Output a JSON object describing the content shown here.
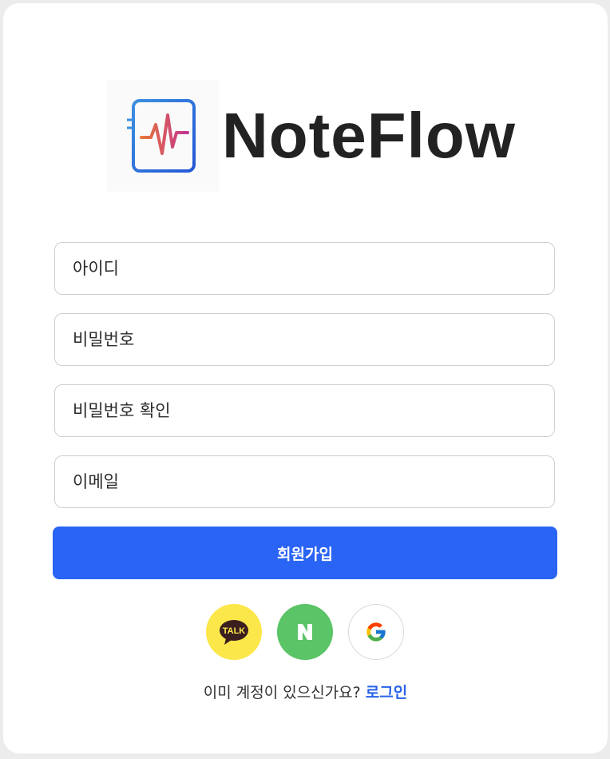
{
  "brand": {
    "name": "NoteFlow",
    "logo_icon": "notebook-waveform-icon"
  },
  "form": {
    "id_placeholder": "아이디",
    "password_placeholder": "비밀번호",
    "password_confirm_placeholder": "비밀번호 확인",
    "email_placeholder": "이메일",
    "submit_label": "회원가입"
  },
  "social": {
    "kakao_label": "TALK",
    "naver_label": "N",
    "google_icon": "google-icon"
  },
  "footer": {
    "question": "이미 계정이 있으신가요?",
    "login_link": "로그인"
  },
  "colors": {
    "primary": "#2a64f5",
    "link": "#2962e8",
    "kakao": "#fbe74a",
    "naver": "#5ac466",
    "logo_gradient_start": "#3d8fe0",
    "logo_gradient_end": "#2458d6",
    "wave_start": "#e8763a",
    "wave_end": "#c2358f"
  }
}
